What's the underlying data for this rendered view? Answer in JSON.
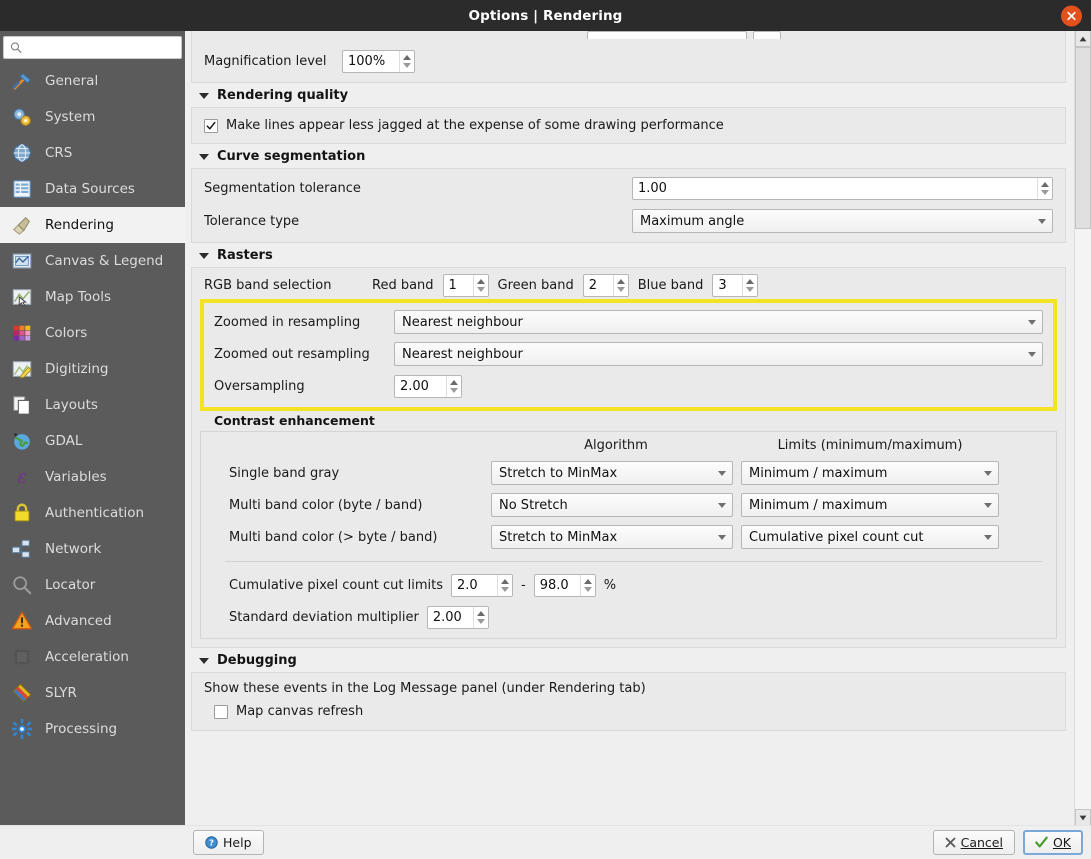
{
  "window": {
    "title": "Options | Rendering",
    "close_icon": "close-icon"
  },
  "sidebar": {
    "search": {
      "value": "",
      "placeholder": "",
      "icon": "search-icon"
    },
    "items": [
      {
        "label": "General",
        "icon": "hammer-wrench-icon"
      },
      {
        "label": "System",
        "icon": "gears-icon"
      },
      {
        "label": "CRS",
        "icon": "globe-grid-icon"
      },
      {
        "label": "Data Sources",
        "icon": "table-icon"
      },
      {
        "label": "Rendering",
        "icon": "paintbrush-icon",
        "active": true
      },
      {
        "label": "Canvas & Legend",
        "icon": "canvas-icon"
      },
      {
        "label": "Map Tools",
        "icon": "map-cursor-icon"
      },
      {
        "label": "Colors",
        "icon": "color-swatches-icon"
      },
      {
        "label": "Digitizing",
        "icon": "pencil-map-icon"
      },
      {
        "label": "Layouts",
        "icon": "pages-icon"
      },
      {
        "label": "GDAL",
        "icon": "earth-icon"
      },
      {
        "label": "Variables",
        "icon": "epsilon-icon"
      },
      {
        "label": "Authentication",
        "icon": "lock-icon"
      },
      {
        "label": "Network",
        "icon": "network-icon"
      },
      {
        "label": "Locator",
        "icon": "magnifier-icon"
      },
      {
        "label": "Advanced",
        "icon": "warning-triangle-icon"
      },
      {
        "label": "Acceleration",
        "icon": "cpu-chip-icon"
      },
      {
        "label": "SLYR",
        "icon": "diamond-icon"
      },
      {
        "label": "Processing",
        "icon": "gear-blue-icon"
      }
    ]
  },
  "content": {
    "magnification": {
      "label": "Magnification level",
      "value": "100%"
    },
    "rendering_quality": {
      "title": "Rendering quality",
      "antialias": {
        "label": "Make lines appear less jagged at the expense of some drawing performance",
        "checked": true
      }
    },
    "curve_segmentation": {
      "title": "Curve segmentation",
      "segmentation_tolerance": {
        "label": "Segmentation tolerance",
        "value": "1.00"
      },
      "tolerance_type": {
        "label": "Tolerance type",
        "value": "Maximum angle"
      }
    },
    "rasters": {
      "title": "Rasters",
      "rgb_band_selection": {
        "label": "RGB band selection",
        "red": {
          "label": "Red band",
          "value": "1"
        },
        "green": {
          "label": "Green band",
          "value": "2"
        },
        "blue": {
          "label": "Blue band",
          "value": "3"
        }
      },
      "resampling": {
        "zoomed_in": {
          "label": "Zoomed in resampling",
          "value": "Nearest neighbour"
        },
        "zoomed_out": {
          "label": "Zoomed out resampling",
          "value": "Nearest neighbour"
        },
        "oversampling": {
          "label": "Oversampling",
          "value": "2.00"
        }
      },
      "contrast_enhancement": {
        "title": "Contrast enhancement",
        "col_algorithm": "Algorithm",
        "col_limits": "Limits (minimum/maximum)",
        "rows": [
          {
            "label": "Single band gray",
            "algorithm": "Stretch to MinMax",
            "limits": "Minimum / maximum"
          },
          {
            "label": "Multi band color (byte / band)",
            "algorithm": "No Stretch",
            "limits": "Minimum / maximum"
          },
          {
            "label": "Multi band color (> byte / band)",
            "algorithm": "Stretch to MinMax",
            "limits": "Cumulative pixel count cut"
          }
        ],
        "cumulative_cut": {
          "label": "Cumulative pixel count cut limits",
          "min": "2.0",
          "separator": "-",
          "max": "98.0",
          "unit": "%"
        },
        "std_dev": {
          "label": "Standard deviation multiplier",
          "value": "2.00"
        }
      }
    },
    "debugging": {
      "title": "Debugging",
      "description": "Show these events in the Log Message panel (under Rendering tab)",
      "map_canvas_refresh": {
        "label": "Map canvas refresh",
        "checked": false
      }
    }
  },
  "footer": {
    "help": "Help",
    "cancel": "Cancel",
    "ok": "OK"
  },
  "colors": {
    "highlight": "#f2e325",
    "titlebar": "#2b2b2b",
    "sidebar": "#5b5b5b",
    "close": "#e2511c",
    "panel": "#eaeaea"
  }
}
